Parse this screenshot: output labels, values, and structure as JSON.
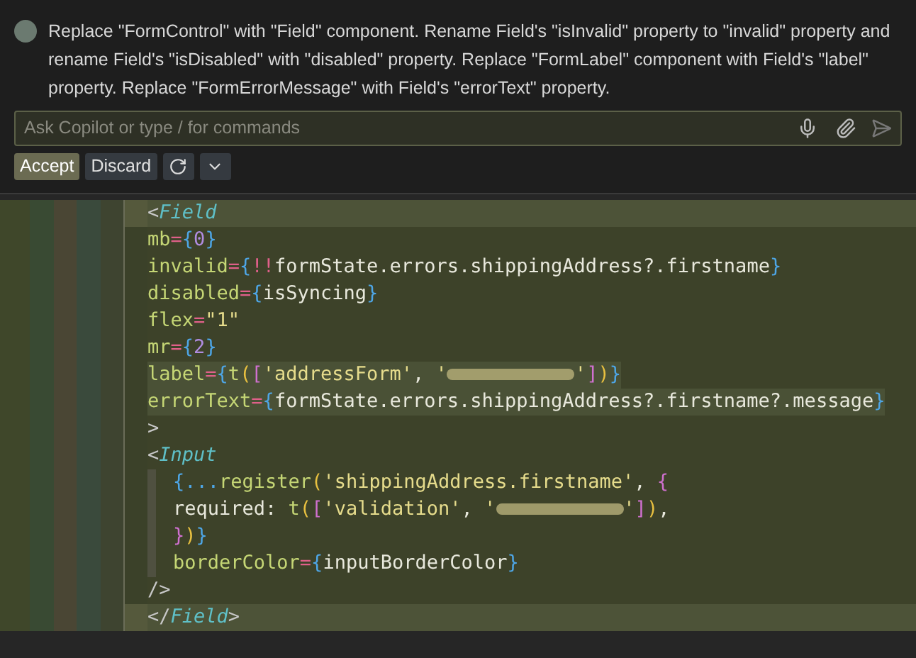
{
  "chat": {
    "message": "Replace \"FormControl\" with \"Field\" component. Rename Field's \"isInvalid\" property to \"invalid\" property and rename Field's \"isDisabled\" with \"disabled\" property. Replace \"FormLabel\" component with Field's \"label\" property. Replace \"FormErrorMessage\" with Field's \"errorText\" property.",
    "input": {
      "placeholder": "Ask Copilot or type / for commands"
    },
    "actions": [
      {
        "label": "Accept",
        "kind": "primary"
      },
      {
        "label": "Discard",
        "kind": "secondary"
      }
    ]
  },
  "code": [
    {
      "highlighted": true,
      "changed": false,
      "tokens": [
        {
          "kind": "punct",
          "text": "<"
        },
        {
          "kind": "tag",
          "text": "Field"
        }
      ]
    },
    {
      "highlighted": false,
      "changed": false,
      "tokens": [
        {
          "kind": "attr",
          "text": "mb"
        },
        {
          "kind": "op",
          "text": "="
        },
        {
          "kind": "brace",
          "text": "{"
        },
        {
          "kind": "num",
          "text": "0"
        },
        {
          "kind": "brace",
          "text": "}"
        }
      ]
    },
    {
      "highlighted": false,
      "changed": false,
      "tokens": [
        {
          "kind": "attr",
          "text": "invalid"
        },
        {
          "kind": "op",
          "text": "="
        },
        {
          "kind": "brace",
          "text": "{"
        },
        {
          "kind": "op",
          "text": "!!"
        },
        {
          "kind": "ident",
          "text": "formState.errors.shippingAddress?.firstname"
        },
        {
          "kind": "brace",
          "text": "}"
        }
      ]
    },
    {
      "highlighted": false,
      "changed": false,
      "tokens": [
        {
          "kind": "attr",
          "text": "disabled"
        },
        {
          "kind": "op",
          "text": "="
        },
        {
          "kind": "brace",
          "text": "{"
        },
        {
          "kind": "ident",
          "text": "isSyncing"
        },
        {
          "kind": "brace",
          "text": "}"
        }
      ]
    },
    {
      "highlighted": false,
      "changed": false,
      "tokens": [
        {
          "kind": "attr",
          "text": "flex"
        },
        {
          "kind": "op",
          "text": "="
        },
        {
          "kind": "str",
          "text": "\"1\""
        }
      ]
    },
    {
      "highlighted": false,
      "changed": false,
      "tokens": [
        {
          "kind": "attr",
          "text": "mr"
        },
        {
          "kind": "op",
          "text": "="
        },
        {
          "kind": "brace",
          "text": "{"
        },
        {
          "kind": "num",
          "text": "2"
        },
        {
          "kind": "brace",
          "text": "}"
        }
      ]
    },
    {
      "highlighted": false,
      "changed": true,
      "tokens": [
        {
          "kind": "attr",
          "text": "label"
        },
        {
          "kind": "op",
          "text": "="
        },
        {
          "kind": "brace",
          "text": "{"
        },
        {
          "kind": "fn",
          "text": "t"
        },
        {
          "kind": "paren",
          "text": "("
        },
        {
          "kind": "bracket",
          "text": "["
        },
        {
          "kind": "str",
          "text": "'addressForm'"
        },
        {
          "kind": "ident",
          "text": ", "
        },
        {
          "kind": "str",
          "text": "'"
        },
        {
          "kind": "redacted"
        },
        {
          "kind": "str",
          "text": "'"
        },
        {
          "kind": "bracket",
          "text": "]"
        },
        {
          "kind": "paren",
          "text": ")"
        },
        {
          "kind": "brace",
          "text": "}"
        }
      ]
    },
    {
      "highlighted": false,
      "changed": true,
      "tokens": [
        {
          "kind": "attr",
          "text": "errorText"
        },
        {
          "kind": "op",
          "text": "="
        },
        {
          "kind": "brace",
          "text": "{"
        },
        {
          "kind": "ident",
          "text": "formState.errors.shippingAddress?.firstname?.message"
        },
        {
          "kind": "brace",
          "text": "}"
        }
      ]
    },
    {
      "highlighted": false,
      "changed": false,
      "tokens": [
        {
          "kind": "punct",
          "text": ">"
        }
      ]
    },
    {
      "highlighted": false,
      "changed": false,
      "tokens": [
        {
          "kind": "punct",
          "text": "<"
        },
        {
          "kind": "tag",
          "text": "Input"
        }
      ],
      "children": [
        {
          "highlighted": false,
          "changed": false,
          "tokens": [
            {
              "kind": "brace",
              "text": "{..."
            },
            {
              "kind": "fn",
              "text": "register"
            },
            {
              "kind": "paren",
              "text": "("
            },
            {
              "kind": "str",
              "text": "'shippingAddress.firstname'"
            },
            {
              "kind": "ident",
              "text": ", "
            },
            {
              "kind": "bracket",
              "text": "{"
            }
          ]
        },
        {
          "highlighted": false,
          "changed": false,
          "tokens": [
            {
              "kind": "ident",
              "text": "required: "
            },
            {
              "kind": "fn",
              "text": "t"
            },
            {
              "kind": "paren",
              "text": "("
            },
            {
              "kind": "bracket",
              "text": "["
            },
            {
              "kind": "str",
              "text": "'validation'"
            },
            {
              "kind": "ident",
              "text": ", "
            },
            {
              "kind": "str",
              "text": "'"
            },
            {
              "kind": "redacted"
            },
            {
              "kind": "str",
              "text": "'"
            },
            {
              "kind": "bracket",
              "text": "]"
            },
            {
              "kind": "paren",
              "text": ")"
            },
            {
              "kind": "ident",
              "text": ","
            }
          ]
        },
        {
          "highlighted": false,
          "changed": false,
          "tokens": [
            {
              "kind": "bracket",
              "text": "}"
            },
            {
              "kind": "paren",
              "text": ")"
            },
            {
              "kind": "brace",
              "text": "}"
            }
          ]
        },
        {
          "highlighted": false,
          "changed": false,
          "tokens": [
            {
              "kind": "attr",
              "text": "borderColor"
            },
            {
              "kind": "op",
              "text": "="
            },
            {
              "kind": "brace",
              "text": "{"
            },
            {
              "kind": "ident",
              "text": "inputBorderColor"
            },
            {
              "kind": "brace",
              "text": "}"
            }
          ]
        }
      ]
    },
    {
      "highlighted": false,
      "changed": false,
      "tokens": [
        {
          "kind": "punct",
          "text": "/>"
        }
      ]
    },
    {
      "highlighted": true,
      "changed": false,
      "tokens": [
        {
          "kind": "punct",
          "text": "</"
        },
        {
          "kind": "tag",
          "text": "Field"
        },
        {
          "kind": "punct",
          "text": ">"
        }
      ]
    }
  ]
}
